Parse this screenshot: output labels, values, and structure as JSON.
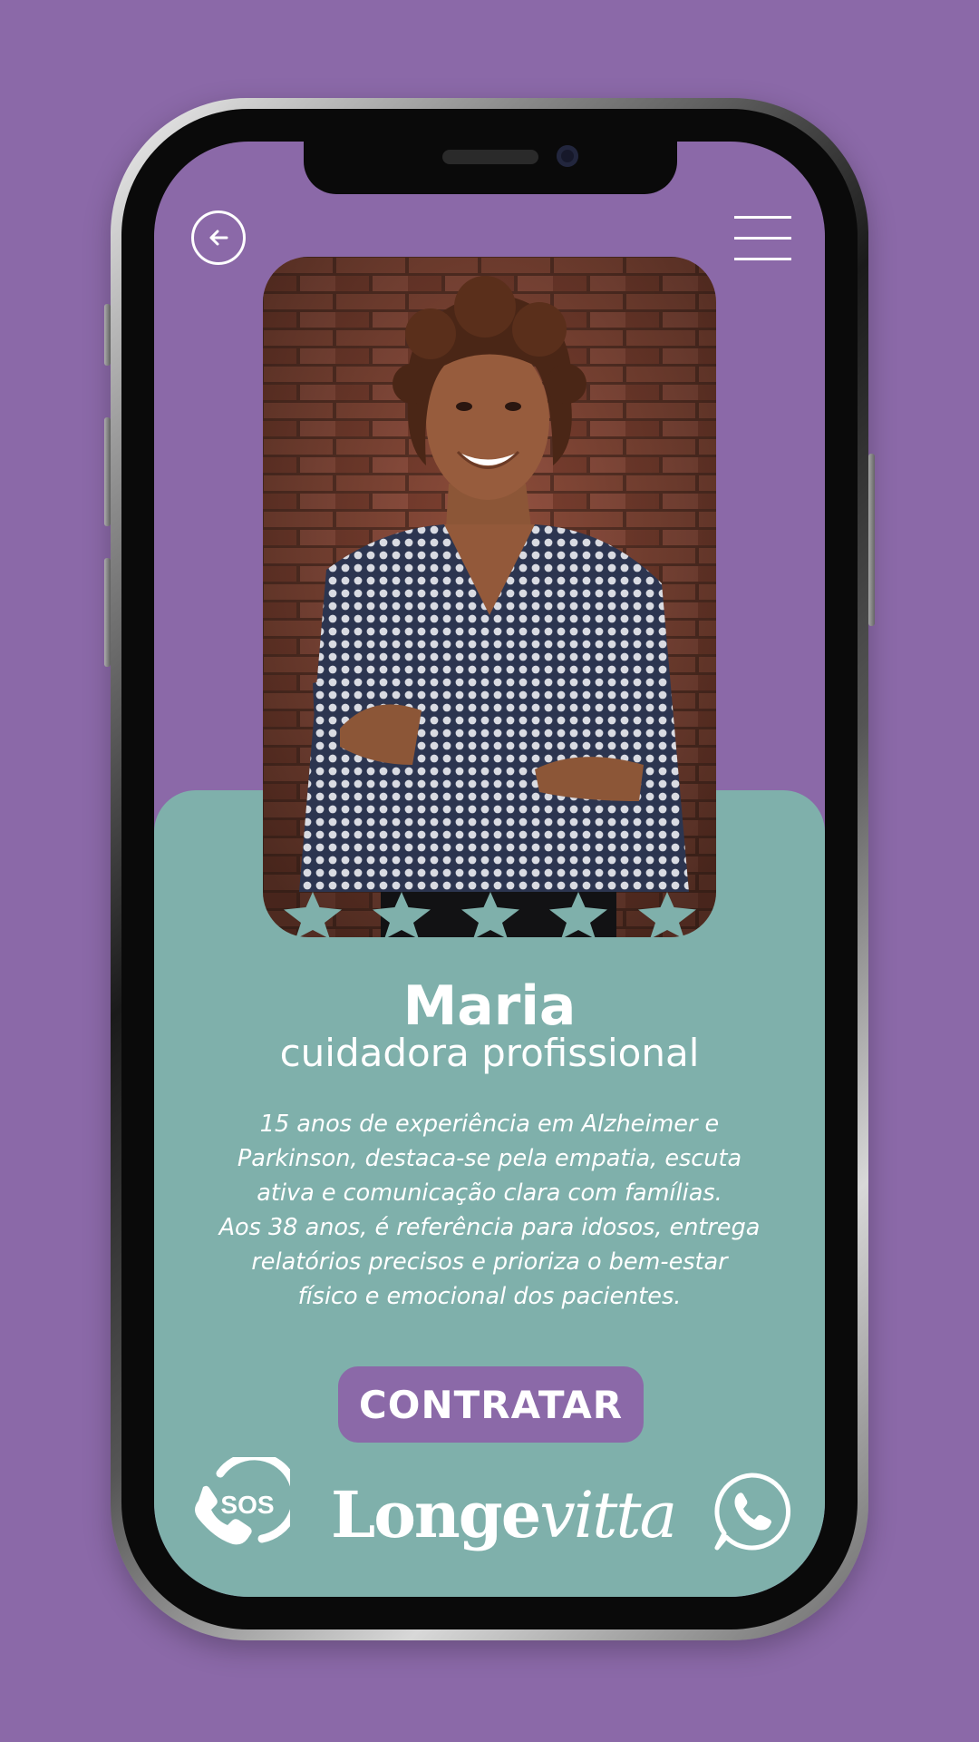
{
  "profile": {
    "name": "Maria",
    "role": "cuidadora profissional",
    "bio_lines": [
      "15 anos de experiência em Alzheimer e",
      "Parkinson, destaca-se pela empatia, escuta",
      "ativa e comunicação clara com famílias.",
      "Aos 38 anos, é referência para idosos, entrega",
      "relatórios precisos e prioriza o bem-estar",
      "físico e emocional dos pacientes."
    ],
    "rating": 5
  },
  "actions": {
    "hire_label": "CONTRATAR",
    "sos_label": "SOS"
  },
  "brand": {
    "logo_regular": "Longe",
    "logo_italic": "vitta"
  },
  "icons": {
    "back": "arrow-left-circle-icon",
    "menu": "hamburger-menu-icon",
    "sos": "sos-phone-icon",
    "whatsapp": "whatsapp-icon",
    "star": "star-icon"
  },
  "colors": {
    "background": "#8b69a8",
    "panel": "#7fb0ab",
    "button": "#8b69a8",
    "text": "#ffffff"
  }
}
